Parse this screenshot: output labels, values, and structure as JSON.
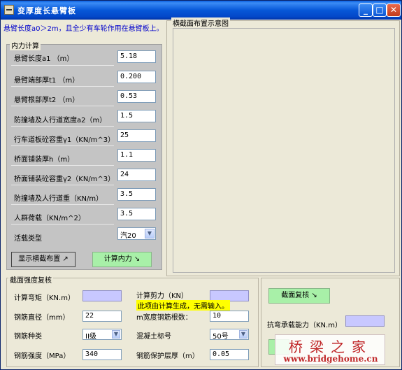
{
  "window": {
    "title": "变厚度长悬臂板"
  },
  "titlebar_buttons": {
    "minimize": "_",
    "maximize": "□",
    "close": "✕"
  },
  "notice": "悬臂长度a0＞2m，且全少有车轮作用在悬臂板上。",
  "internal": {
    "legend": "内力计算",
    "rows": [
      {
        "label": "悬臂长度a1  （m）",
        "value": "5.18"
      },
      {
        "label": "悬臂端部厚t1 （m）",
        "value": "0.200"
      },
      {
        "label": "悬臂根部厚t2 （m）",
        "value": "0.53"
      },
      {
        "label": "防撞墙及人行道宽度a2（m）",
        "value": "1.5"
      },
      {
        "label": "行车道板砼容重γ1（KN/m^3）",
        "value": "25"
      },
      {
        "label": "桥面铺装厚h（m）",
        "value": "1.1"
      },
      {
        "label": "桥面铺装砼容重γ2（KN/m^3）",
        "value": "24"
      },
      {
        "label": "防撞墙及人行道重（KN/m）",
        "value": "3.5"
      },
      {
        "label": "人群荷载（KN/m^2）",
        "value": "3.5"
      }
    ],
    "load_type_label": "活载类型",
    "load_type_value": "汽20",
    "show_section_button": "显示横截布置 ↗",
    "compute_button": "计算内力 ↘"
  },
  "diagram": {
    "legend": "横截面布置示意图"
  },
  "strength": {
    "legend": "截面强度复核",
    "moment_label": "计算弯矩（KN.m）",
    "shear_label": "计算剪力（KN）",
    "hint": "此项由计算生成，无需输入。",
    "diameter_label": "钢筋直径（mm）",
    "diameter_value": "22",
    "bars_per_m_label": "m宽度钢筋根数：",
    "bars_per_m_value": "10",
    "rebar_type_label": "钢筋种类",
    "rebar_type_value": "II级",
    "concrete_grade_label": "混凝土标号",
    "concrete_grade_value": "50号",
    "rebar_strength_label": "钢筋强度（MPa）",
    "rebar_strength_value": "340",
    "cover_label": "钢筋保护层厚（m）",
    "cover_value": "0.05"
  },
  "right_panel": {
    "check_button": "截面复核 ↘",
    "capacity_label": "抗弯承载能力（KN.m）"
  },
  "watermark": {
    "cn": "桥梁之家",
    "url": "www.bridgehome.cn"
  },
  "colors": {
    "titlebar": "#0758d8",
    "notice": "#0000cc",
    "output_field": "#c8c8ff",
    "green_button": "#a8f0a8",
    "hint_bg": "#ffff00",
    "watermark": "#c0282a"
  }
}
